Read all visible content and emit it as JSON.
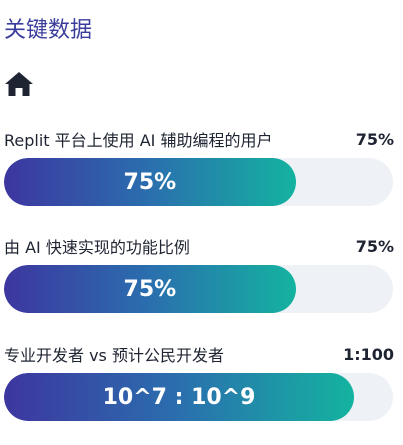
{
  "page": {
    "title": "关键数据",
    "home_icon": "home-icon"
  },
  "metrics": [
    {
      "label": "Replit 平台上使用 AI 辅助编程的用户",
      "value": "75%",
      "bar_text": "75%",
      "fill_fraction": 0.75
    },
    {
      "label": "由 AI 快速实现的功能比例",
      "value": "75%",
      "bar_text": "75%",
      "fill_fraction": 0.75
    },
    {
      "label": "专业开发者 vs 预计公民开发者",
      "value": "1:100",
      "bar_text": "10^7 : 10^9",
      "fill_fraction": 0.9
    }
  ],
  "colors": {
    "title": "#3b3d9c",
    "gradient_start": "#3d36a0",
    "gradient_end": "#14b3a0",
    "track": "#eef1f5"
  }
}
